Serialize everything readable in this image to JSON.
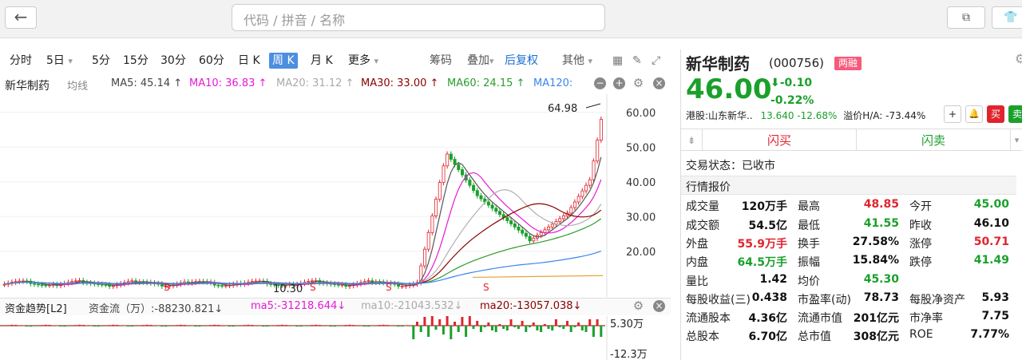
{
  "topbar": {
    "back_icon": "←",
    "search_placeholder": "代码 / 拼音 / 名称",
    "window_icon": "⧉",
    "shirt_icon": "👕"
  },
  "toolbar": {
    "periods": [
      "分时",
      "5日",
      "5分",
      "15分",
      "30分",
      "60分",
      "日 K",
      "周 K",
      "月 K",
      "更多"
    ],
    "active_period": "周 K",
    "right": [
      "筹码",
      "叠加",
      "后复权",
      "其他"
    ]
  },
  "ma_row": {
    "name": "新华制药",
    "line_type": "均线",
    "ma5": "MA5: 45.14 ↑",
    "ma10": "MA10: 36.83 ↑",
    "ma20": "MA20: 31.12 ↑",
    "ma30": "MA30: 33.00 ↑",
    "ma60": "MA60: 24.15 ↑",
    "ma120": "MA120:"
  },
  "chart_data": {
    "type": "candlestick",
    "y_ticks": [
      "60.00",
      "50.00",
      "40.00",
      "30.00",
      "20.00"
    ],
    "high_label": "64.98",
    "low_label": "10.30",
    "s_markers": [
      "S",
      "S",
      "S",
      "S"
    ],
    "colors": {
      "up": "#e0242e",
      "down": "#1aa02b",
      "ma5": "#555555",
      "ma10": "#e619d6",
      "ma20": "#b0b0b0",
      "ma30": "#8b0000",
      "ma60": "#2b9b2b",
      "ma120": "#3a85f0",
      "ma250": "#e5a43c"
    }
  },
  "fund_row": {
    "title": "资金趋势[L2]",
    "flow": "资金流（万）:-88230.821↓",
    "ma5": "ma5:-31218.644↓",
    "ma10": "ma10:-21043.532↓",
    "ma20": "ma20:-13057.038↓",
    "y_top": "5.30万",
    "y_bottom": "-12.3万"
  },
  "quote": {
    "name": "新华制药",
    "code": "(000756)",
    "badge": "两融",
    "price": "46.00",
    "change": "-0.10",
    "change_pct": "-0.22%",
    "hk_label": "港股:山东新华..",
    "hk_value": "13.640 -12.68%",
    "premium": "溢价H/A: -73.44%",
    "buttons": [
      "+",
      "🔔",
      "买",
      "卖"
    ],
    "flash_buy": "闪买",
    "flash_sell": "闪卖",
    "status": "交易状态：已收市",
    "section": "行情报价",
    "rows": [
      [
        [
          "成交量",
          "120万手",
          "blk"
        ],
        [
          "最高",
          "48.85",
          "red"
        ],
        [
          "今开",
          "45.00",
          "green"
        ]
      ],
      [
        [
          "成交额",
          "54.5亿",
          "blk"
        ],
        [
          "最低",
          "41.55",
          "green"
        ],
        [
          "昨收",
          "46.10",
          "blk"
        ]
      ],
      [
        [
          "外盘",
          "55.9万手",
          "red"
        ],
        [
          "换手",
          "27.58%",
          "blk"
        ],
        [
          "涨停",
          "50.71",
          "red"
        ]
      ],
      [
        [
          "内盘",
          "64.5万手",
          "green"
        ],
        [
          "振幅",
          "15.84%",
          "blk"
        ],
        [
          "跌停",
          "41.49",
          "green"
        ]
      ],
      [
        [
          "量比",
          "1.42",
          "blk"
        ],
        [
          "均价",
          "45.30",
          "green"
        ],
        [
          "",
          "",
          "blk"
        ]
      ],
      [
        [
          "每股收益(三)",
          "0.438",
          "blk"
        ],
        [
          "市盈率(动)",
          "78.73",
          "blk"
        ],
        [
          "每股净资产",
          "5.93",
          "blk"
        ]
      ],
      [
        [
          "流通股本",
          "4.36亿",
          "blk"
        ],
        [
          "流通市值",
          "201亿元",
          "blk"
        ],
        [
          "市净率",
          "7.75",
          "blk"
        ]
      ],
      [
        [
          "总股本",
          "6.70亿",
          "blk"
        ],
        [
          "总市值",
          "308亿元",
          "blk"
        ],
        [
          "ROE",
          "7.77%",
          "blk"
        ]
      ]
    ]
  }
}
